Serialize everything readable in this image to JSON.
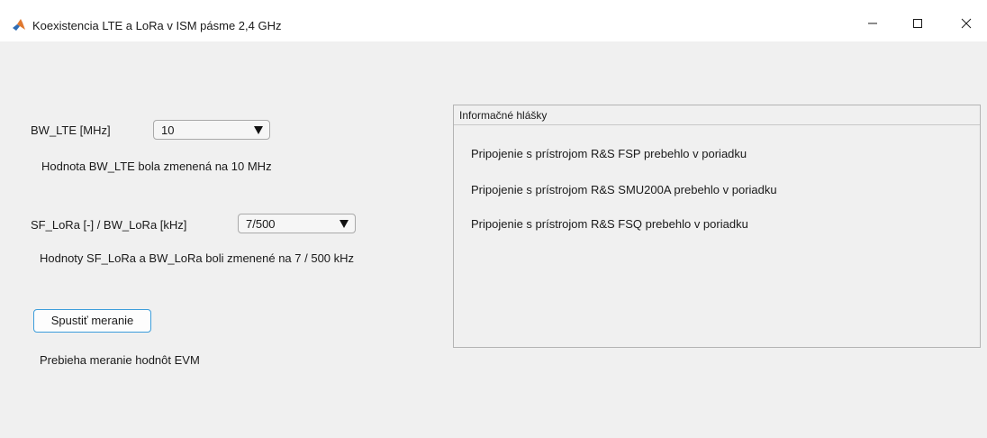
{
  "window": {
    "title": "Koexistencia LTE a LoRa v ISM pásme 2,4 GHz",
    "icon": "matlab-logo-icon",
    "controls": {
      "minimize": "—",
      "maximize": "☐",
      "close": "✕"
    }
  },
  "bw_lte": {
    "label": "BW_LTE [MHz]",
    "selected": "10",
    "status": "Hodnota BW_LTE bola zmenená na 10 MHz"
  },
  "sf_lora": {
    "label": "SF_LoRa [-] / BW_LoRa [kHz]",
    "selected": "7/500",
    "status": "Hodnoty SF_LoRa a BW_LoRa boli zmenené na 7 / 500 kHz"
  },
  "measurement": {
    "button_label": "Spustiť meranie",
    "status": "Prebieha meranie hodnôt EVM"
  },
  "info_panel": {
    "title": "Informačné hlášky",
    "messages": [
      "Pripojenie s prístrojom R&S FSP prebehlo v poriadku",
      "Pripojenie s prístrojom R&S SMU200A prebehlo v poriadku",
      "Pripojenie s prístrojom R&S FSQ prebehlo v poriadku"
    ]
  },
  "colors": {
    "window_background": "#f0f0f0",
    "titlebar_background": "#ffffff",
    "button_focus_border": "#3c9ddb",
    "panel_border": "#b4b4b4"
  }
}
